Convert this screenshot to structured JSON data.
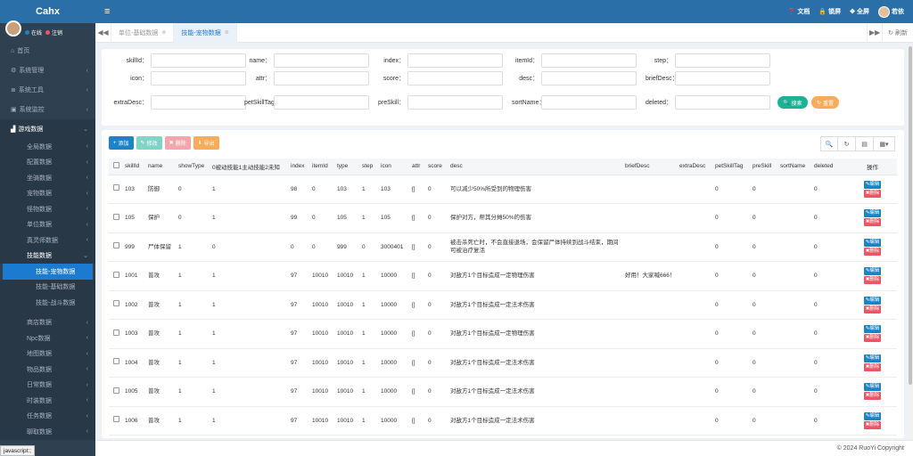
{
  "brand": "Cahx",
  "user": {
    "online_label": "在线",
    "logout_label": "注销",
    "online_color": "#1c84c6",
    "logout_color": "#ed5565",
    "name": "若依"
  },
  "sidebar": {
    "top_items": [
      {
        "label": "首页",
        "icon": "home-icon"
      },
      {
        "label": "系统管理",
        "icon": "gear-icon"
      },
      {
        "label": "系统工具",
        "icon": "bars-icon"
      },
      {
        "label": "系统监控",
        "icon": "video-icon"
      },
      {
        "label": "游戏数据",
        "icon": "chart-icon"
      }
    ],
    "game_sub": [
      "全局数据",
      "配置数据",
      "坐骑数据",
      "宠物数据",
      "怪物数据",
      "单位数据",
      "真灵师数据",
      "技能数据"
    ],
    "skill_sub": [
      "技能-宠物数据",
      "技能-基础数据",
      "技能-战斗数据"
    ],
    "game_sub2": [
      "商店数据",
      "Npc数据",
      "地图数据",
      "物品数据",
      "日常数据",
      "时装数据",
      "任务数据",
      "聊取数据"
    ]
  },
  "header": {
    "docs": "文档",
    "lock": "锁屏",
    "fullscreen": "全屏"
  },
  "tabs": [
    {
      "label": "单位-基础数据",
      "active": false
    },
    {
      "label": "技能-宠物数据",
      "active": true
    }
  ],
  "tabs_refresh": "刷新",
  "search": {
    "fields": [
      "skillId",
      "name",
      "index",
      "itemId",
      "step",
      "icon",
      "attr",
      "score",
      "desc",
      "briefDesc",
      "extraDesc",
      "petSkillTag",
      "preSkill",
      "sortName",
      "deleted"
    ],
    "search_btn": "搜索",
    "reset_btn": "重置"
  },
  "toolbar": {
    "add": "添加",
    "edit": "修改",
    "delete": "删除",
    "export": "导出"
  },
  "table": {
    "headers": [
      "skillId",
      "name",
      "showType",
      "0被动技能1主动技能2未知",
      "index",
      "itemId",
      "type",
      "step",
      "icon",
      "attr",
      "score",
      "desc",
      "briefDesc",
      "extraDesc",
      "petSkillTag",
      "preSkill",
      "sortName",
      "deleted",
      "操作"
    ],
    "op_edit": "编辑",
    "op_delete": "删除",
    "rows": [
      [
        "103",
        "防御",
        "0",
        "1",
        "98",
        "0",
        "103",
        "1",
        "103",
        "[]",
        "0",
        "可以减少50%所受到的物理伤害",
        "",
        "",
        "0",
        "0",
        "",
        "0"
      ],
      [
        "105",
        "保护",
        "0",
        "1",
        "99",
        "0",
        "105",
        "1",
        "105",
        "[]",
        "0",
        "保护对方，帮其分摊50%的伤害",
        "",
        "",
        "0",
        "0",
        "",
        "0"
      ],
      [
        "999",
        "尸体保留",
        "1",
        "0",
        "0",
        "0",
        "999",
        "0",
        "3000401",
        "[]",
        "0",
        "被击杀死亡时，不会直接退场，会保留尸体持续到战斗结束，期间可被治疗复活",
        "",
        "",
        "0",
        "0",
        "",
        "0"
      ],
      [
        "1001",
        "普攻",
        "1",
        "1",
        "97",
        "10010",
        "10010",
        "1",
        "10000",
        "[]",
        "0",
        "对敌方1个目标造成一定物理伤害",
        "好用！大家喊666！",
        "",
        "0",
        "0",
        "",
        "0"
      ],
      [
        "1002",
        "普攻",
        "1",
        "1",
        "97",
        "10010",
        "10010",
        "1",
        "10000",
        "[]",
        "0",
        "对敌方1个目标造成一定法术伤害",
        "",
        "",
        "0",
        "0",
        "",
        "0"
      ],
      [
        "1003",
        "普攻",
        "1",
        "1",
        "97",
        "10010",
        "10010",
        "1",
        "10000",
        "[]",
        "0",
        "对敌方1个目标造成一定物理伤害",
        "",
        "",
        "0",
        "0",
        "",
        "0"
      ],
      [
        "1004",
        "普攻",
        "1",
        "1",
        "97",
        "10010",
        "10010",
        "1",
        "10000",
        "[]",
        "0",
        "对敌方1个目标造成一定法术伤害",
        "",
        "",
        "0",
        "0",
        "",
        "0"
      ],
      [
        "1005",
        "普攻",
        "1",
        "1",
        "97",
        "10010",
        "10010",
        "1",
        "10000",
        "[]",
        "0",
        "对敌方1个目标造成一定法术伤害",
        "",
        "",
        "0",
        "0",
        "",
        "0"
      ],
      [
        "1006",
        "普攻",
        "1",
        "1",
        "97",
        "10010",
        "10010",
        "1",
        "10000",
        "[]",
        "0",
        "对敌方1个目标造成一定法术伤害",
        "",
        "",
        "0",
        "0",
        "",
        "0"
      ]
    ]
  },
  "footer": "© 2024 RuoYi Copyright",
  "statusbar": "javascript:;"
}
